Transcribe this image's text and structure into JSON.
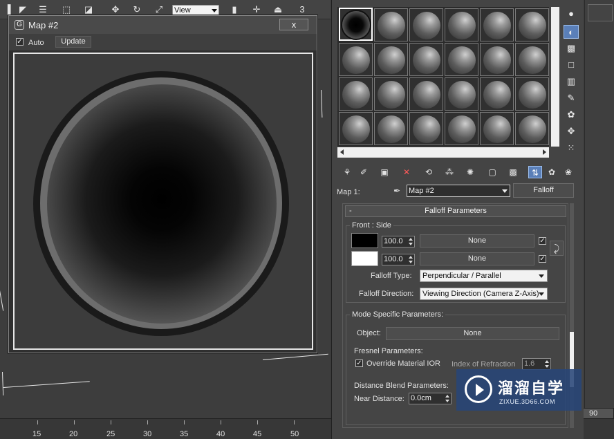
{
  "top_toolbar": {
    "view_select": "View",
    "counter": "3"
  },
  "map_window": {
    "title": "Map #2",
    "close_label": "x",
    "auto_label": "Auto",
    "update_label": "Update"
  },
  "material_editor": {
    "map_label": "Map 1:",
    "map_name": "Map #2",
    "map_type": "Falloff",
    "rollup_title": "Falloff Parameters",
    "front_side": {
      "title": "Front : Side",
      "slot1": {
        "amount": "100.0",
        "map": "None",
        "color": "#000000"
      },
      "slot2": {
        "amount": "100.0",
        "map": "None",
        "color": "#ffffff"
      }
    },
    "falloff_type_label": "Falloff Type:",
    "falloff_type_value": "Perpendicular / Parallel",
    "falloff_direction_label": "Falloff Direction:",
    "falloff_direction_value": "Viewing Direction (Camera Z-Axis)",
    "mode_specific": {
      "title": "Mode Specific Parameters:",
      "object_label": "Object:",
      "object_value": "None",
      "fresnel_label": "Fresnel Parameters:",
      "override_ior_label": "Override Material IOR",
      "ior_label": "Index of Refraction",
      "ior_value": "1.6",
      "distance_blend_label": "Distance Blend Parameters:",
      "near_distance_label": "Near Distance:",
      "near_distance_value": "0.0cm"
    }
  },
  "timeline": {
    "ticks": [
      "15",
      "20",
      "25",
      "30",
      "35",
      "40",
      "45",
      "50"
    ],
    "right_label": "90"
  },
  "watermark": {
    "cn": "溜溜自学",
    "en": "ZIXUE.3D66.COM"
  }
}
